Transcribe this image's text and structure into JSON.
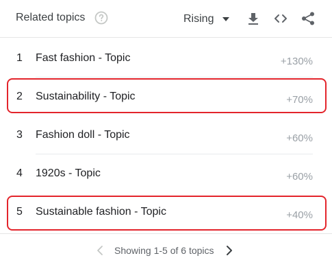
{
  "header": {
    "title": "Related topics",
    "sort_value": "Rising",
    "icons": {
      "help": "help-circle-icon",
      "caret": "caret-down-icon",
      "download": "download-icon",
      "embed": "code-icon",
      "share": "share-icon"
    }
  },
  "rows": [
    {
      "rank": "1",
      "topic": "Fast fashion - Topic",
      "value": "+130%",
      "highlighted": false
    },
    {
      "rank": "2",
      "topic": "Sustainability - Topic",
      "value": "+70%",
      "highlighted": true
    },
    {
      "rank": "3",
      "topic": "Fashion doll - Topic",
      "value": "+60%",
      "highlighted": false
    },
    {
      "rank": "4",
      "topic": "1920s - Topic",
      "value": "+60%",
      "highlighted": false
    },
    {
      "rank": "5",
      "topic": "Sustainable fashion - Topic",
      "value": "+40%",
      "highlighted": true
    }
  ],
  "footer": {
    "pager_text": "Showing 1-5 of 6 topics",
    "prev_icon": "chevron-left-icon",
    "next_icon": "chevron-right-icon"
  },
  "colors": {
    "highlight": "#e3242b",
    "muted_text": "#9aa0a6",
    "text": "#202124",
    "divider": "#e8eaed"
  }
}
